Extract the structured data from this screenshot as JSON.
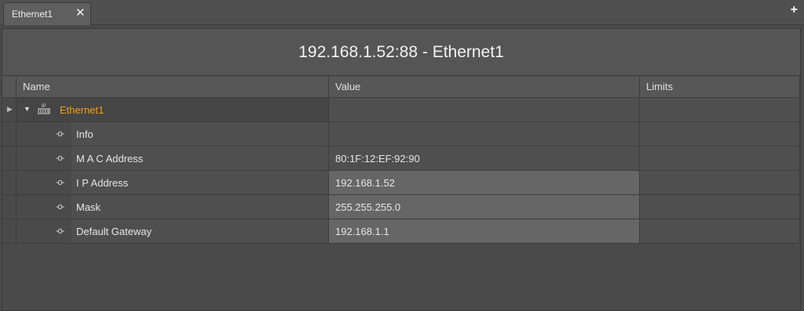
{
  "tab": {
    "label": "Ethernet1",
    "close": "✕",
    "add": "+"
  },
  "title": "192.168.1.52:88 - Ethernet1",
  "columns": {
    "name": "Name",
    "value": "Value",
    "limits": "Limits"
  },
  "root": {
    "name": "Ethernet1",
    "value": "",
    "limits": ""
  },
  "rows": [
    {
      "name": "Info",
      "value": "",
      "limits": ""
    },
    {
      "name": "M A C Address",
      "value": "80:1F:12:EF:92:90",
      "limits": ""
    },
    {
      "name": "I P Address",
      "value": "192.168.1.52",
      "limits": ""
    },
    {
      "name": "Mask",
      "value": "255.255.255.0",
      "limits": ""
    },
    {
      "name": "Default Gateway",
      "value": "192.168.1.1",
      "limits": ""
    }
  ],
  "colors": {
    "accent": "#f0a020",
    "background": "#4a4a4a"
  },
  "icons": {
    "node": "network-card-icon",
    "property": "connector-icon"
  }
}
